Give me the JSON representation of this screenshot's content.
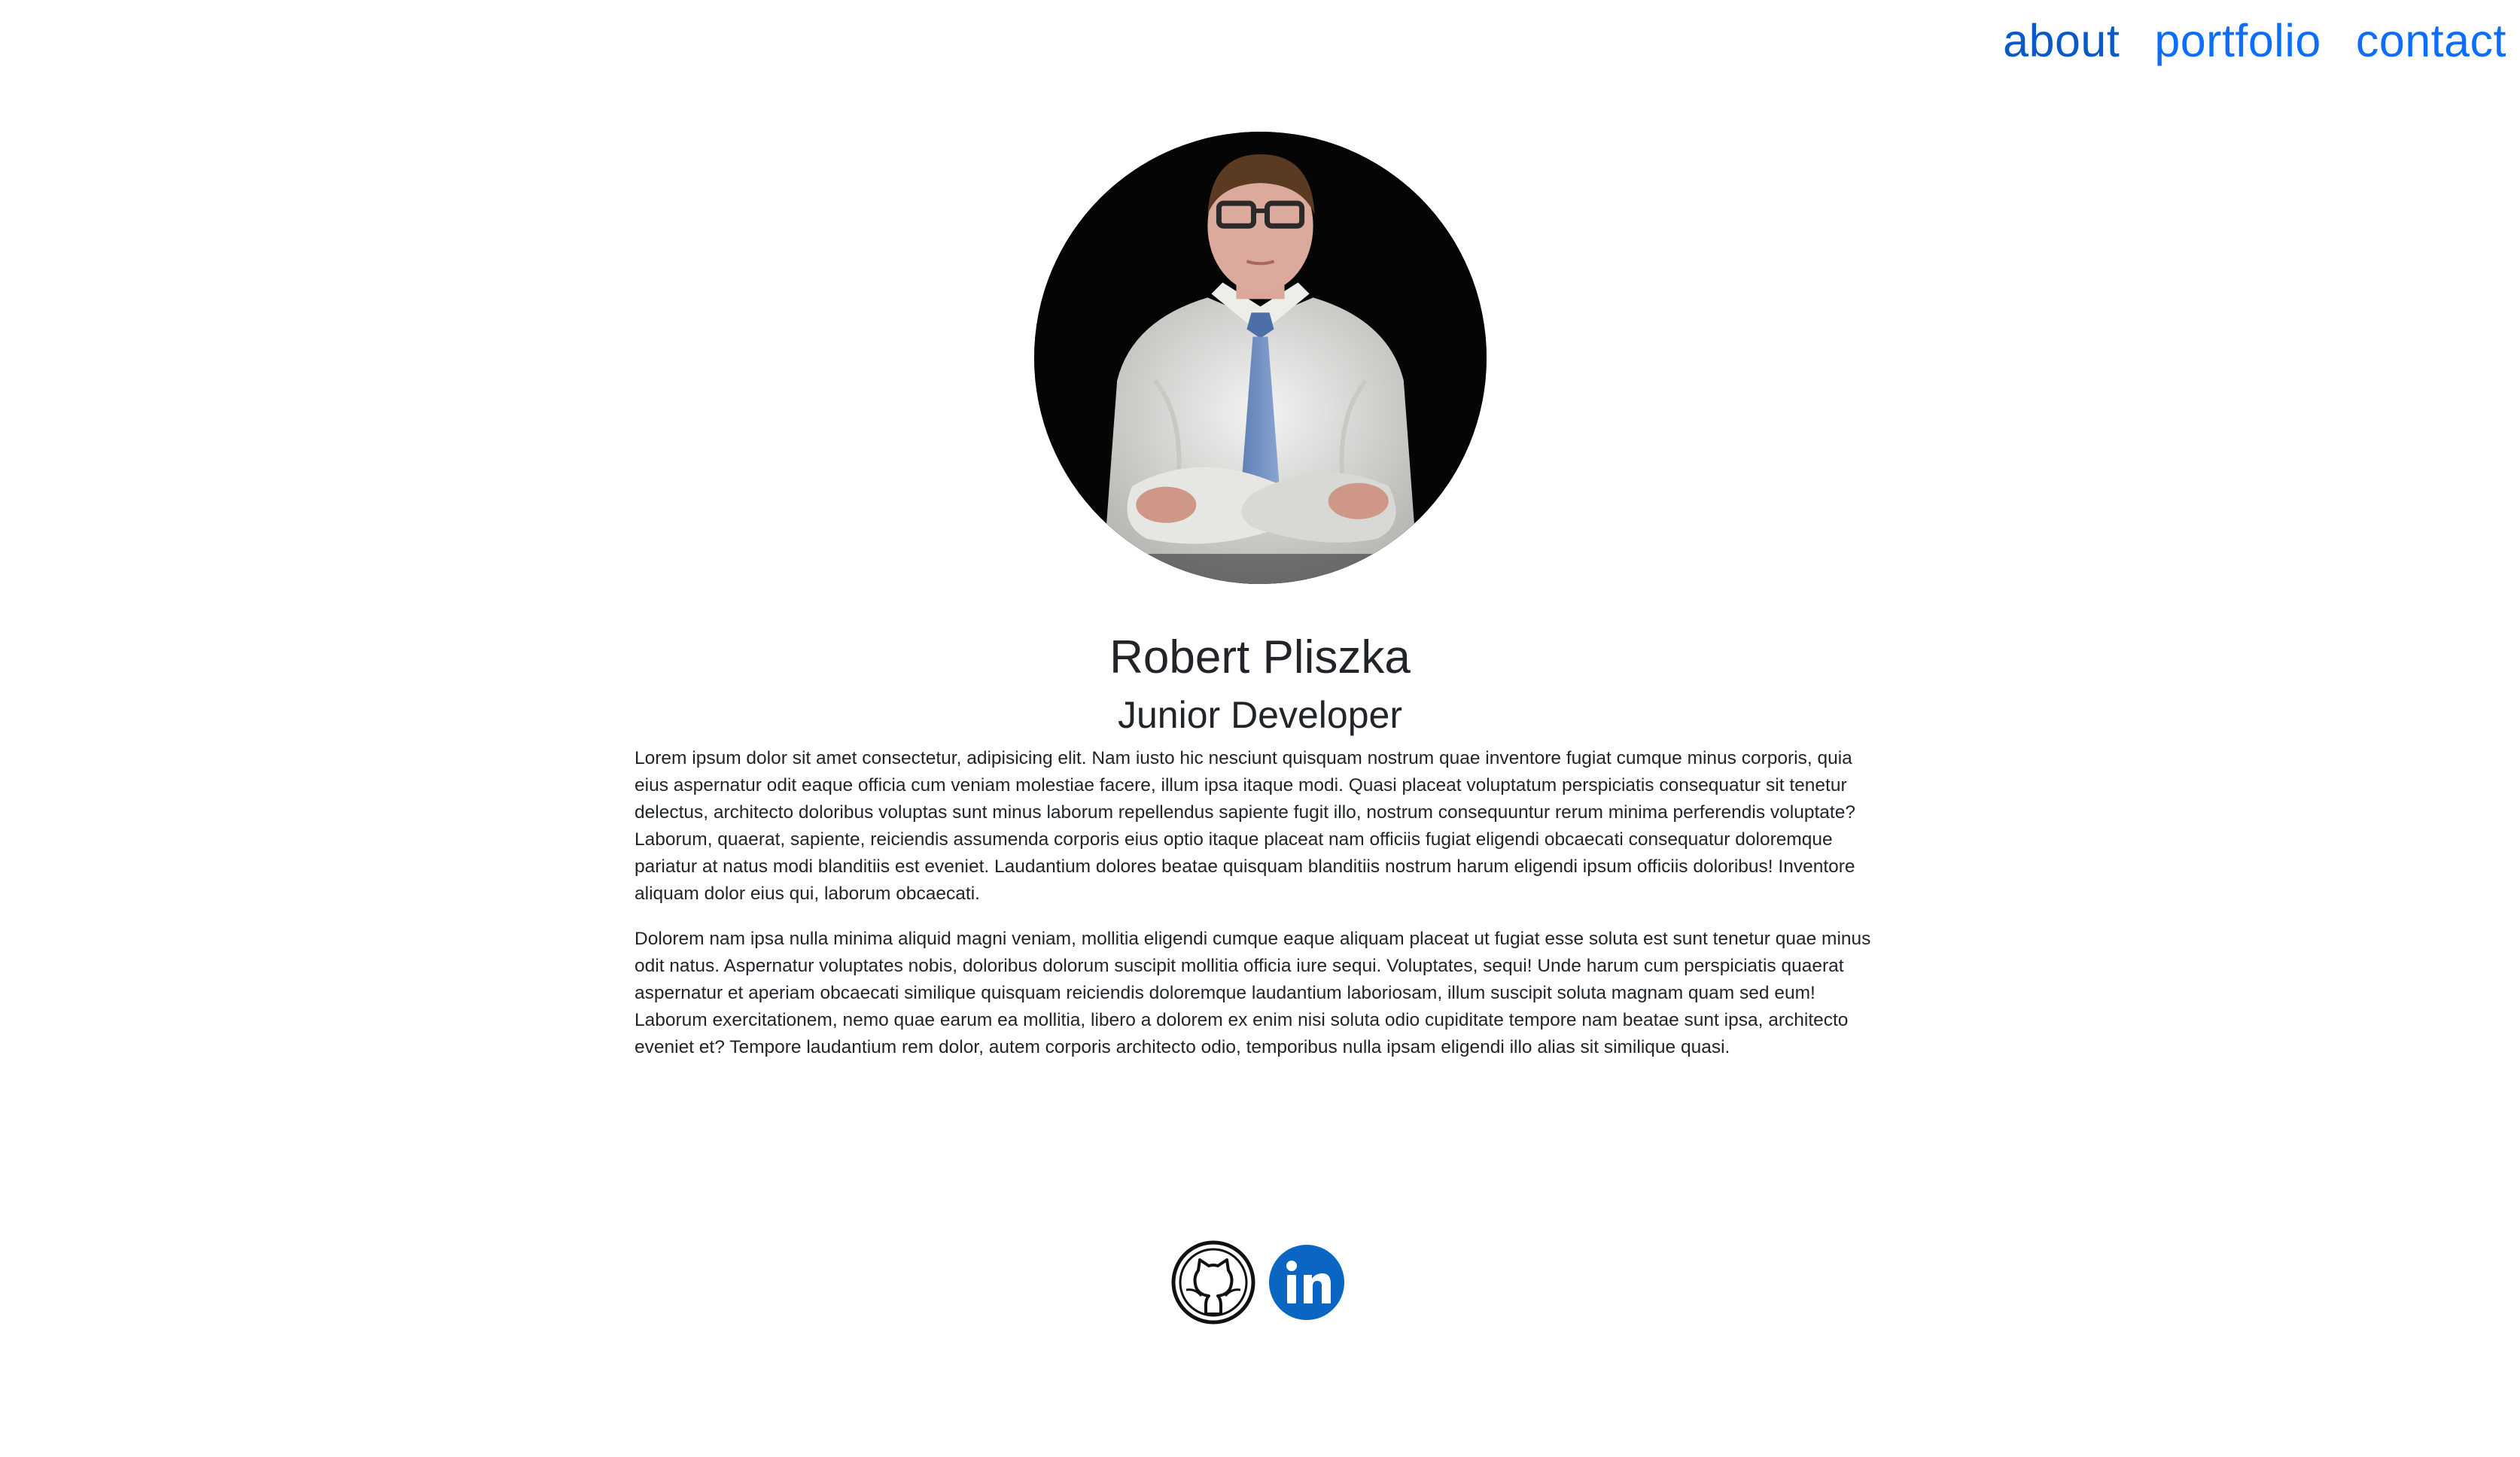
{
  "nav": {
    "items": [
      {
        "label": "about",
        "active": true
      },
      {
        "label": "portfolio",
        "active": false
      },
      {
        "label": "contact",
        "active": false
      }
    ]
  },
  "profile": {
    "name": "Robert Pliszka",
    "role": "Junior Developer"
  },
  "bio": [
    "Lorem ipsum dolor sit amet consectetur, adipisicing elit. Nam iusto hic nesciunt quisquam nostrum quae inventore fugiat cumque minus corporis, quia eius aspernatur odit eaque officia cum veniam molestiae facere, illum ipsa itaque modi. Quasi placeat voluptatum perspiciatis consequatur sit tenetur delectus, architecto doloribus voluptas sunt minus laborum repellendus sapiente fugit illo, nostrum consequuntur rerum minima perferendis voluptate? Laborum, quaerat, sapiente, reiciendis assumenda corporis eius optio itaque placeat nam officiis fugiat eligendi obcaecati consequatur doloremque pariatur at natus modi blanditiis est eveniet. Laudantium dolores beatae quisquam blanditiis nostrum harum eligendi ipsum officiis doloribus! Inventore aliquam dolor eius qui, laborum obcaecati.",
    "Dolorem nam ipsa nulla minima aliquid magni veniam, mollitia eligendi cumque eaque aliquam placeat ut fugiat esse soluta est sunt tenetur quae minus odit natus. Aspernatur voluptates nobis, doloribus dolorum suscipit mollitia officia iure sequi. Voluptates, sequi! Unde harum cum perspiciatis quaerat aspernatur et aperiam obcaecati similique quisquam reiciendis doloremque laudantium laboriosam, illum suscipit soluta magnam quam sed eum! Laborum exercitationem, nemo quae earum ea mollitia, libero a dolorem ex enim nisi soluta odio cupiditate tempore nam beatae sunt ipsa, architecto eveniet et? Tempore laudantium rem dolor, autem corporis architecto odio, temporibus nulla ipsam eligendi illo alias sit similique quasi."
  ],
  "socials": [
    {
      "icon": "github-icon"
    },
    {
      "icon": "linkedin-icon",
      "color": "#0a66c2"
    }
  ],
  "colors": {
    "link": "#0d6efd",
    "link_active": "#0a58ca",
    "text": "#212529",
    "linkedin": "#0a66c2"
  }
}
